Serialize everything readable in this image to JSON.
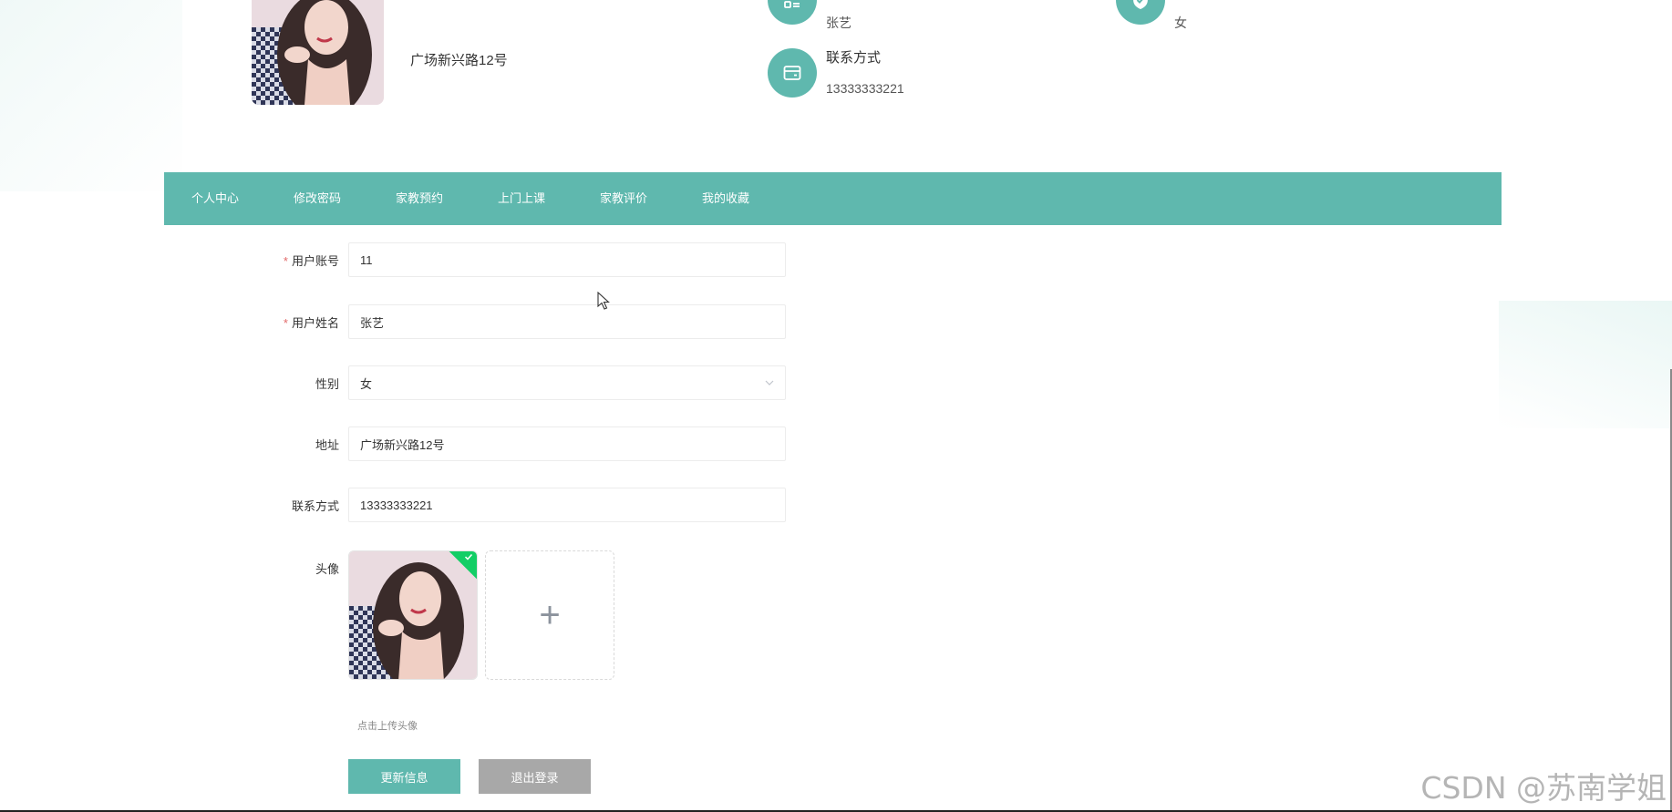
{
  "profile": {
    "address": "广场新兴路12号",
    "name_value": "张艺",
    "gender_value": "女",
    "contact_label": "联系方式",
    "contact_value": "13333333221"
  },
  "nav": {
    "items": [
      {
        "label": "个人中心"
      },
      {
        "label": "修改密码"
      },
      {
        "label": "家教预约"
      },
      {
        "label": "上门上课"
      },
      {
        "label": "家教评价"
      },
      {
        "label": "我的收藏"
      }
    ]
  },
  "form": {
    "account_label": "用户账号",
    "account_value": "11",
    "name_label": "用户姓名",
    "name_value": "张艺",
    "gender_label": "性别",
    "gender_value": "女",
    "address_label": "地址",
    "address_value": "广场新兴路12号",
    "contact_label": "联系方式",
    "contact_value": "13333333221",
    "avatar_label": "头像",
    "avatar_add": "+",
    "upload_tip": "点击上传头像",
    "required_mark": "*"
  },
  "buttons": {
    "update": "更新信息",
    "logout": "退出登录"
  },
  "watermark": "CSDN @苏南学姐",
  "colors": {
    "accent": "#5fb8ae",
    "logout_button": "#a8a8a8",
    "success": "#13ce66"
  },
  "icons": {
    "name_info": "user-list-icon",
    "gender_info": "shield-check-icon",
    "contact_info": "wallet-card-icon",
    "select": "chevron-down-icon",
    "upload_success": "check-icon",
    "add": "plus-icon"
  }
}
